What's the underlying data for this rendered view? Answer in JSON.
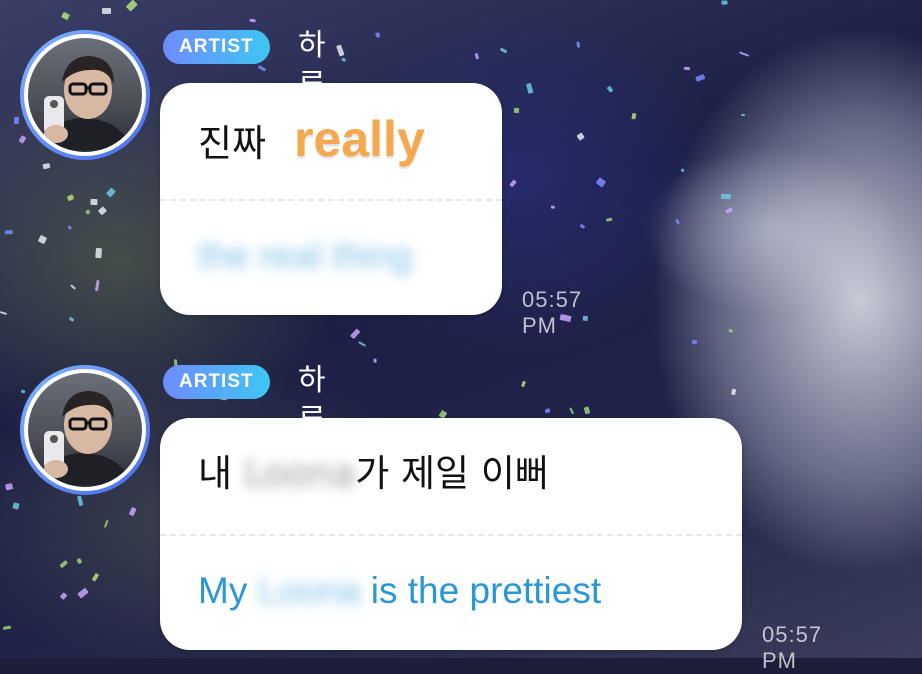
{
  "messages": [
    {
      "badge": "ARTIST",
      "sender": "하루",
      "heart": "💙",
      "original_text": "진짜",
      "annotation": "really",
      "translation": "the real thing",
      "time": "05:57 PM"
    },
    {
      "badge": "ARTIST",
      "sender": "하루",
      "heart": "💙",
      "original_prefix": "내",
      "original_blurred": "Loona",
      "original_suffix": "가 제일 이뻐",
      "translation_prefix": "My",
      "translation_blurred": "Loona",
      "translation_suffix": "is the prettiest",
      "time": "05:57 PM"
    }
  ],
  "colors": {
    "badge_start": "#6f8cff",
    "badge_end": "#3ec6f2",
    "translation_text": "#2a97d8",
    "annotation_text": "#f4a94e",
    "heart": "#7fc4ff"
  },
  "icons": {
    "avatar": "profile-photo",
    "heart": "blue-heart-icon"
  }
}
